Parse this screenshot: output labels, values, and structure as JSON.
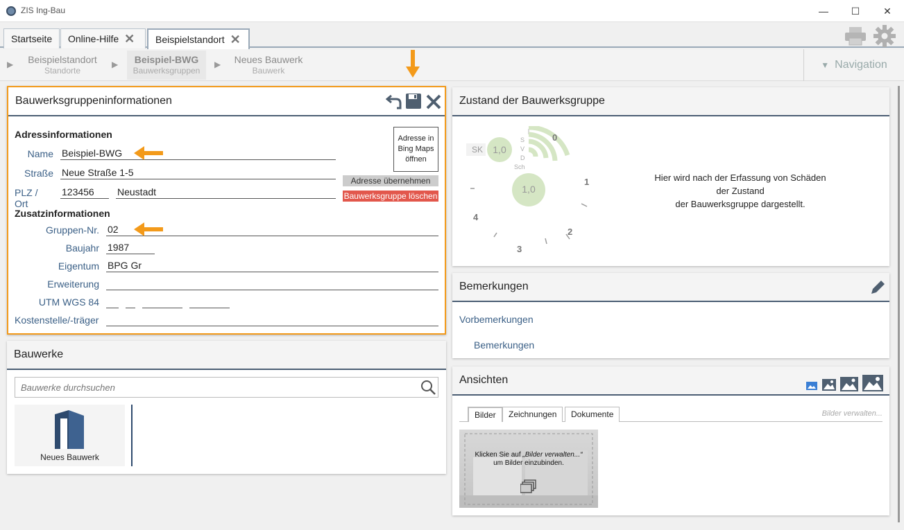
{
  "window": {
    "title": "ZIS Ing-Bau",
    "minimize": "—",
    "maximize": "☐",
    "close": "✕"
  },
  "tabs": [
    {
      "label": "Startseite"
    },
    {
      "label": "Online-Hilfe",
      "close": "✕"
    },
    {
      "label": "Beispielstandort",
      "close": "✕"
    }
  ],
  "breadcrumb": [
    {
      "title": "Beispielstandort",
      "sub": "Standorte"
    },
    {
      "title": "Beispiel-BWG",
      "sub": "Bauwerksgruppen"
    },
    {
      "title": "Neues Bauwerk",
      "sub": "Bauwerk"
    }
  ],
  "navigation": {
    "label": "Navigation"
  },
  "info_panel": {
    "title": "Bauwerksgruppeninformationen",
    "address_heading": "Adressinformationen",
    "name_label": "Name",
    "name_value": "Beispiel-BWG",
    "street_label": "Straße",
    "street_value": "Neue Straße 1-5",
    "zip_label": "PLZ / Ort",
    "zip_value": "123456",
    "city_value": "Neustadt",
    "bing_button": "Adresse in Bing Maps öffnen",
    "apply_address_button": "Adresse übernehmen",
    "delete_button": "Bauwerksgruppe löschen",
    "extra_heading": "Zusatzinformationen",
    "group_no_label": "Gruppen-Nr.",
    "group_no_value": "02",
    "year_label": "Baujahr",
    "year_value": "1987",
    "owner_label": "Eigentum",
    "owner_value": "BPG Gr",
    "extension_label": "Erweiterung",
    "extension_value": "",
    "utm_label": "UTM WGS 84",
    "cost_label": "Kostenstelle/-träger",
    "cost_value": ""
  },
  "bauwerke_panel": {
    "title": "Bauwerke",
    "search_placeholder": "Bauwerke durchsuchen",
    "tile_label": "Neues Bauwerk"
  },
  "zustand_panel": {
    "title": "Zustand der Bauwerksgruppe",
    "sk_label": "SK",
    "sk_value": "1,0",
    "center_value": "1,0",
    "letters": [
      "S",
      "V",
      "D",
      "Sch"
    ],
    "scale": [
      "0",
      "1",
      "2",
      "3",
      "4"
    ],
    "message_line1": "Hier wird nach der Erfassung von Schäden",
    "message_line2": "der Zustand",
    "message_line3": "der Bauwerksgruppe dargestellt."
  },
  "bemerkungen_panel": {
    "title": "Bemerkungen",
    "vorbemerkungen": "Vorbemerkungen",
    "bemerkungen": "Bemerkungen"
  },
  "ansichten_panel": {
    "title": "Ansichten",
    "tabs": [
      "Bilder",
      "Zeichnungen",
      "Dokumente"
    ],
    "manage_link": "Bilder verwalten...",
    "placeholder_line1_pre": "Klicken Sie auf ",
    "placeholder_line1_em": "„Bilder verwalten...“",
    "placeholder_line2": "um Bilder einzubinden."
  },
  "colors": {
    "accent_orange": "#f39a1a",
    "header_line": "#4a5d73",
    "delete_red": "#e2574c",
    "label_blue": "#3a5f86"
  }
}
